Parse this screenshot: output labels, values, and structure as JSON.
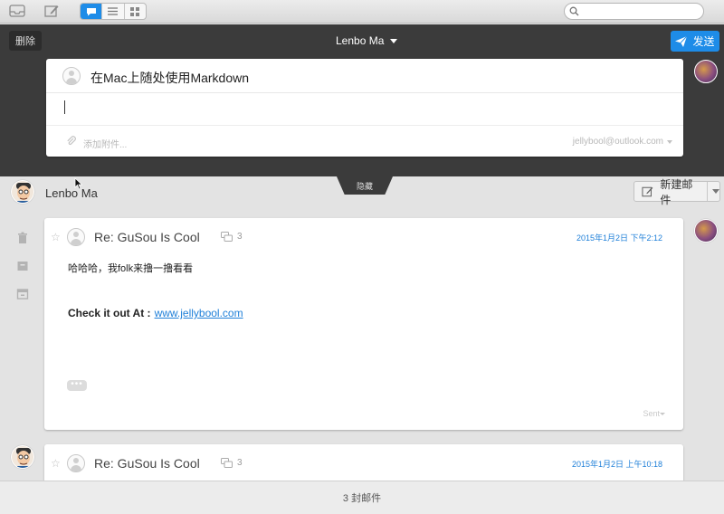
{
  "toolbar": {
    "search_placeholder": ""
  },
  "compose": {
    "delete_label": "删除",
    "account_name": "Lenbo Ma",
    "send_label": "发送",
    "subject": "在Mac上随处使用Markdown",
    "attach_label": "添加附件...",
    "from_email": "jellybool@outlook.com",
    "hide_label": "隐藏"
  },
  "thread": {
    "name": "Lenbo Ma",
    "new_mail_label": "新建邮件"
  },
  "messages": [
    {
      "subject": "Re: GuSou Is Cool",
      "count": "3",
      "date": "2015年1月2日 下午2:12",
      "body_line1": "哈哈哈，我folk来撸一撸看看",
      "body_bold": "Check it out At :",
      "body_link": "www.jellybool.com",
      "more": "•••",
      "sent_label": "Sent"
    },
    {
      "subject": "Re: GuSou Is Cool",
      "count": "3",
      "date": "2015年1月2日 上午10:18"
    }
  ],
  "footer": {
    "count_label": "3 封邮件"
  },
  "colors": {
    "accent": "#1e8ce8",
    "compose_bg": "#3b3b3b",
    "link": "#1e7fd8"
  }
}
